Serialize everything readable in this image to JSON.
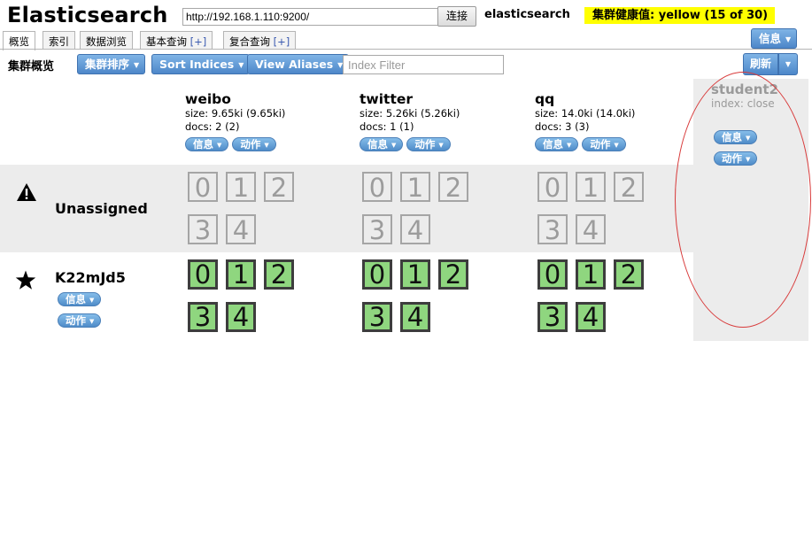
{
  "header": {
    "app_title": "Elasticsearch",
    "url_value": "http://192.168.1.110:9200/",
    "connect_label": "连接",
    "cluster_name": "elasticsearch",
    "health": "集群健康值: yellow (15 of 30)",
    "info_label": "信息"
  },
  "tabs": [
    {
      "label": "概览"
    },
    {
      "label": "索引"
    },
    {
      "label": "数据浏览"
    },
    {
      "label": "基本查询",
      "plus": "[+]"
    },
    {
      "label": "复合查询",
      "plus": "[+]"
    }
  ],
  "toolbar": {
    "overview_label": "集群概览",
    "sort_cluster_label": "集群排序",
    "sort_indices_label": "Sort Indices",
    "view_aliases_label": "View Aliases",
    "index_filter_placeholder": "Index Filter",
    "refresh_label": "刷新"
  },
  "indices": [
    {
      "name": "weibo",
      "size": "size: 9.65ki (9.65ki)",
      "docs": "docs: 2 (2)",
      "info": "信息",
      "action": "动作"
    },
    {
      "name": "twitter",
      "size": "size: 5.26ki (5.26ki)",
      "docs": "docs: 1 (1)",
      "info": "信息",
      "action": "动作"
    },
    {
      "name": "qq",
      "size": "size: 14.0ki (14.0ki)",
      "docs": "docs: 3 (3)",
      "info": "信息",
      "action": "动作"
    }
  ],
  "closed_index": {
    "name": "student2",
    "state": "index: close",
    "info": "信息",
    "action": "动作"
  },
  "rows": {
    "unassigned": {
      "label": "Unassigned",
      "icon": "warning-icon"
    },
    "node": {
      "label": "K22mJd5",
      "icon": "star-icon",
      "info": "信息",
      "action": "动作"
    }
  },
  "shards": [
    "0",
    "1",
    "2",
    "3",
    "4"
  ],
  "colors": {
    "health": "#ffff00",
    "shard_started": "#8fd67f",
    "button": "#4d87c9",
    "annotation": "#d83a3a"
  }
}
